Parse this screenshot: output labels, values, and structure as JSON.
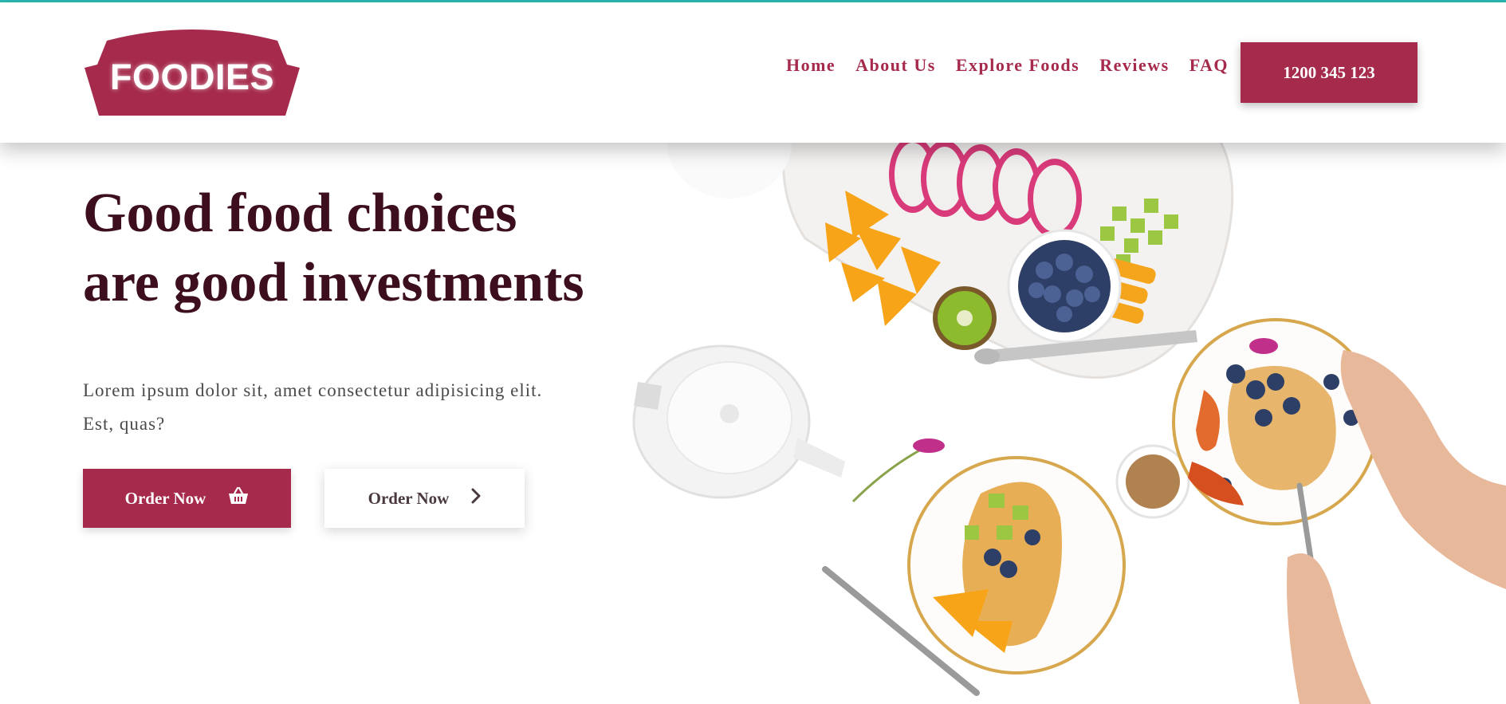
{
  "brand": {
    "logo_text": "FOODIES",
    "accent": "#a52a4b",
    "top_line": "#2ab7b2",
    "heading_color": "#3d0f1e"
  },
  "nav": {
    "items": [
      "Home",
      "About Us",
      "Explore Foods",
      "Reviews",
      "FAQ"
    ]
  },
  "header": {
    "phone_button": "1200 345 123"
  },
  "hero": {
    "headline_line1": "Good food choices",
    "headline_line2": "are good investments",
    "subtext_line1": "Lorem ipsum dolor sit, amet consectetur adipisicing elit.",
    "subtext_line2": "Est, quas?",
    "primary_button": {
      "label": "Order Now",
      "icon": "basket-icon"
    },
    "secondary_button": {
      "label": "Order Now",
      "icon": "chevron-right-icon"
    }
  }
}
